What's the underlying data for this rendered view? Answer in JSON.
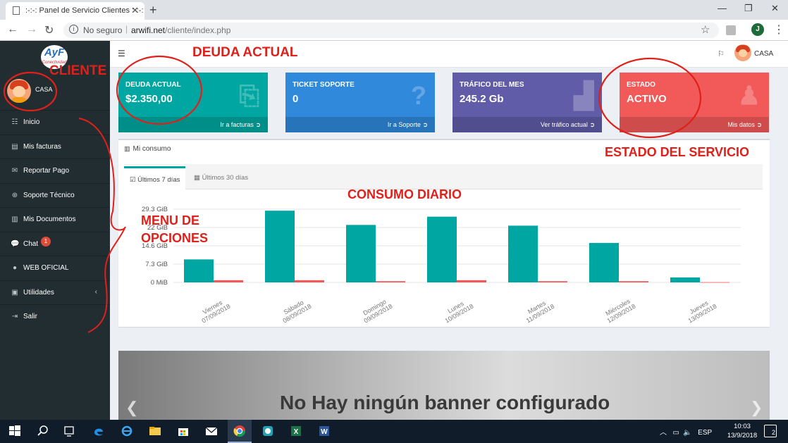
{
  "browser": {
    "tab_title": ":-:-: Panel de Servicio Clientes :-:-:",
    "url_security": "No seguro",
    "url_domain": "arwifi.net",
    "url_path": "/cliente/index.php",
    "profile_initial": "J"
  },
  "sidebar": {
    "logo_text": "AyF",
    "logo_subtext": "Conectividad",
    "username": "CASA",
    "items": [
      {
        "label": "Inicio",
        "icon": "dashboard-icon"
      },
      {
        "label": "Mis facturas",
        "icon": "invoice-icon"
      },
      {
        "label": "Reportar Pago",
        "icon": "envelope-icon"
      },
      {
        "label": "Soporte Técnico",
        "icon": "globe-icon"
      },
      {
        "label": "Mis Documentos",
        "icon": "document-icon"
      },
      {
        "label": "Chat",
        "icon": "chat-icon",
        "badge": "1"
      },
      {
        "label": "WEB OFICIAL",
        "icon": "info-icon"
      },
      {
        "label": "Utilidades",
        "icon": "briefcase-icon"
      },
      {
        "label": "Salir",
        "icon": "logout-icon"
      }
    ]
  },
  "topbar": {
    "username": "CASA"
  },
  "boxes": [
    {
      "label": "DEUDA ACTUAL",
      "value": "$2.350,00",
      "link": "Ir a facturas",
      "color": "#00a7a2",
      "icon": "pdf-file-icon"
    },
    {
      "label": "TICKET SOPORTE",
      "value": "0",
      "link": "Ir a Soporte",
      "color": "#3089db",
      "icon": "question-circle-icon"
    },
    {
      "label": "TRÁFICO DEL MES",
      "value": "245.2 Gb",
      "link": "Ver tráfico actual",
      "color": "#605ca8",
      "icon": "bar-chart-icon"
    },
    {
      "label": "ESTADO",
      "value": "ACTIVO",
      "link": "Mis datos",
      "color": "#f25a59",
      "icon": "person-icon"
    }
  ],
  "consumo": {
    "title": "Mi consumo",
    "tabs": [
      "Últimos 7 días",
      "Últimos 30 días"
    ]
  },
  "chart_data": {
    "type": "bar",
    "categories": [
      [
        "Viernes",
        "07/09/2018"
      ],
      [
        "Sábado",
        "08/09/2018"
      ],
      [
        "Domingo",
        "09/09/2018"
      ],
      [
        "Lunes",
        "10/09/2018"
      ],
      [
        "Martes",
        "11/09/2018"
      ],
      [
        "Miércoles",
        "12/09/2018"
      ],
      [
        "Jueves",
        "13/09/2018"
      ]
    ],
    "y_ticks": [
      "0 MiB",
      "7.3 GiB",
      "14.6 GiB",
      "22 GiB",
      "29.3 GiB"
    ],
    "ylim": [
      0,
      29.3
    ],
    "series": [
      {
        "values": [
          9.2,
          28.7,
          23.0,
          26.3,
          22.7,
          15.8,
          2.0
        ],
        "color": "#00a7a2"
      },
      {
        "values": [
          0.9,
          0.9,
          0.5,
          0.9,
          0.5,
          0.5,
          0.1
        ],
        "color": "#f25a59"
      }
    ],
    "grid": true
  },
  "banner": {
    "text": "No  Hay ningún banner configurado"
  },
  "annotations": {
    "deuda": "DEUDA ACTUAL",
    "cliente": "CLIENTE",
    "estado": "ESTADO DEL SERVICIO",
    "consumo": "CONSUMO DIARIO",
    "menu_line1": "MENU DE",
    "menu_line2": "OPCIONES"
  },
  "taskbar": {
    "language": "ESP",
    "time": "10:03",
    "date": "13/9/2018",
    "notifications": "2"
  }
}
